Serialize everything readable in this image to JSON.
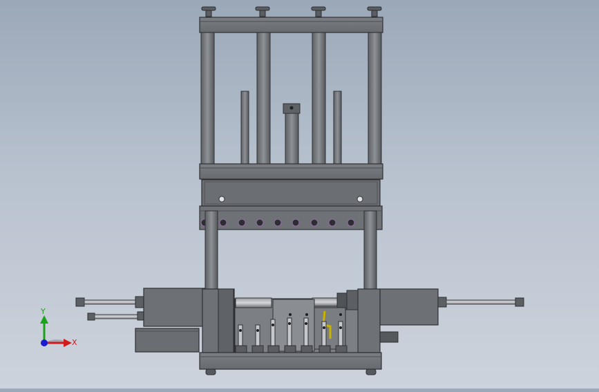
{
  "triad": {
    "x_label": "X",
    "y_label": "Y",
    "colors": {
      "x": "#d11a1a",
      "y": "#1aa31a",
      "z": "#1a1ad1"
    }
  },
  "palette": {
    "metal": "#6f7277",
    "metal_light": "#8d9095",
    "metal_dark": "#4a4c50",
    "highlight": "#c9ccd1",
    "accent_yellow": "#c8b400"
  }
}
